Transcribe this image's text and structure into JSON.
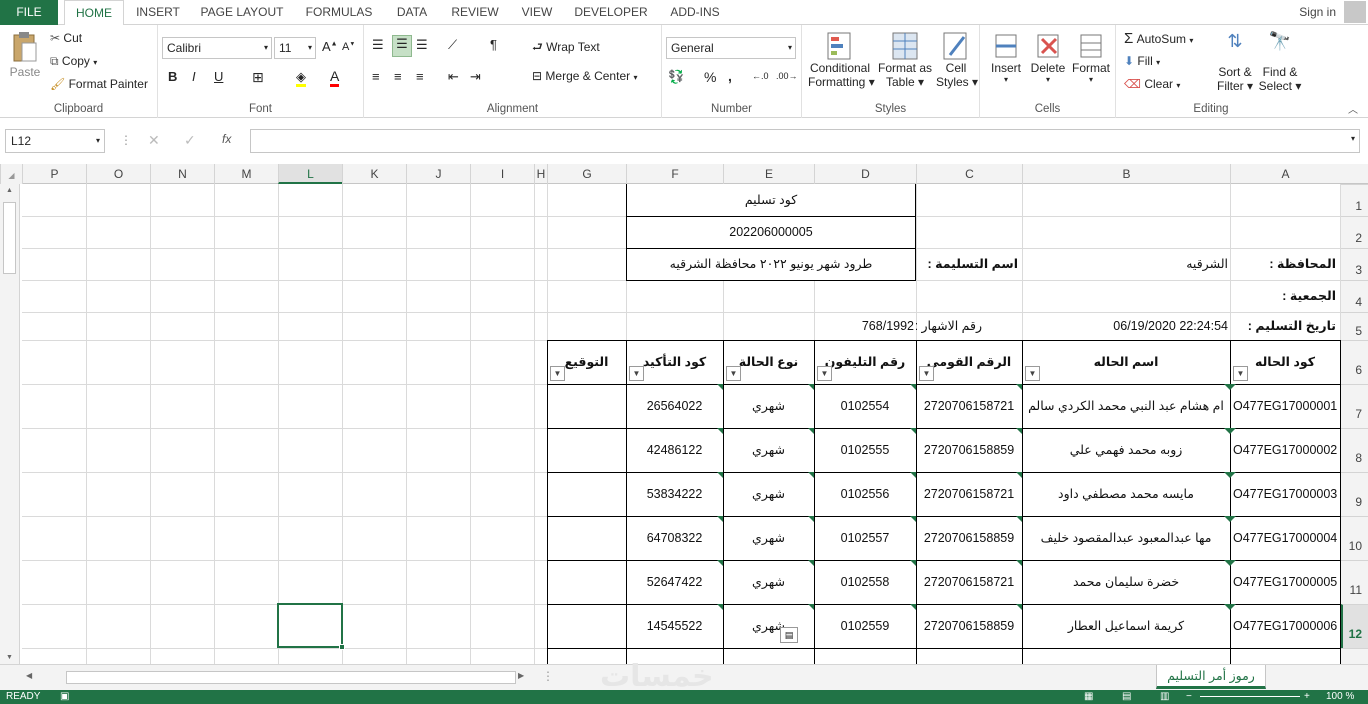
{
  "tabs": [
    "FILE",
    "HOME",
    "INSERT",
    "PAGE LAYOUT",
    "FORMULAS",
    "DATA",
    "REVIEW",
    "VIEW",
    "DEVELOPER",
    "ADD-INS"
  ],
  "signin": "Sign in",
  "clipboard": {
    "paste": "Paste",
    "cut": "Cut",
    "copy": "Copy",
    "format_painter": "Format Painter",
    "label": "Clipboard"
  },
  "font": {
    "name": "Calibri",
    "size": "11",
    "label": "Font",
    "bold": "B",
    "italic": "I",
    "underline": "U"
  },
  "alignment": {
    "wrap": "Wrap Text",
    "merge": "Merge & Center",
    "label": "Alignment"
  },
  "number": {
    "format": "General",
    "label": "Number",
    "percent": "%",
    "comma": ","
  },
  "styles": {
    "cond": "Conditional",
    "cond2": "Formatting",
    "fmt_table": "Format as",
    "fmt_table2": "Table",
    "cell_styles": "Cell",
    "cell_styles2": "Styles",
    "label": "Styles"
  },
  "cells": {
    "insert": "Insert",
    "delete": "Delete",
    "format": "Format",
    "label": "Cells"
  },
  "editing": {
    "autosum": "AutoSum",
    "fill": "Fill",
    "clear": "Clear",
    "sort": "Sort &",
    "sort2": "Filter",
    "find": "Find &",
    "find2": "Select",
    "label": "Editing"
  },
  "formula_bar": {
    "name_box": "L12",
    "fx": "fx",
    "value": ""
  },
  "columns": [
    {
      "id": "P"
    },
    {
      "id": "O"
    },
    {
      "id": "N"
    },
    {
      "id": "M"
    },
    {
      "id": "L"
    },
    {
      "id": "K"
    },
    {
      "id": "J"
    },
    {
      "id": "I"
    },
    {
      "id": "H"
    },
    {
      "id": "G"
    },
    {
      "id": "F"
    },
    {
      "id": "E"
    },
    {
      "id": "D"
    },
    {
      "id": "C"
    },
    {
      "id": "B"
    },
    {
      "id": "A"
    }
  ],
  "rows": [
    "1",
    "2",
    "3",
    "4",
    "5",
    "6",
    "7",
    "8",
    "9",
    "10",
    "11",
    "12"
  ],
  "header_block": {
    "code_label": "كود تسليم",
    "code_value": "202206000005",
    "description": "طرود شهر يونيو ٢٠٢٢ محافظة الشرقيه",
    "delivery_name_label": "اسم التسليمة :",
    "governorate_label": "المحافظة :",
    "governorate_value": "الشرقيه",
    "association_label": "الجمعية :",
    "delivery_date_label": "تاريخ التسليم :",
    "delivery_date_value": "06/19/2020 22:24:54",
    "announcement_label": "رقم الاشهار :",
    "announcement_value": "768/1992"
  },
  "table": {
    "headers": {
      "A": "كود الحاله",
      "B": "اسم الحاله",
      "C": "الرقم القومي",
      "D": "رقم التليفون",
      "E": "نوع الحالة",
      "F": "كود التأكيد",
      "G": "التوقيع"
    },
    "rows": [
      {
        "A": "O477EG17000001",
        "B": "ام هشام عبد النبي محمد الكردي سالم",
        "C": "2720706158721",
        "D": "0102554",
        "E": "شهري",
        "F": "26564022",
        "G": ""
      },
      {
        "A": "O477EG17000002",
        "B": "زوبه محمد فهمي علي",
        "C": "2720706158859",
        "D": "0102555",
        "E": "شهري",
        "F": "42486122",
        "G": ""
      },
      {
        "A": "O477EG17000003",
        "B": "مايسه محمد مصطفي داود",
        "C": "2720706158721",
        "D": "0102556",
        "E": "شهري",
        "F": "53834222",
        "G": ""
      },
      {
        "A": "O477EG17000004",
        "B": "مها عبدالمعبود عبدالمقصود خليف",
        "C": "2720706158859",
        "D": "0102557",
        "E": "شهري",
        "F": "64708322",
        "G": ""
      },
      {
        "A": "O477EG17000005",
        "B": "خضرة سليمان محمد",
        "C": "2720706158721",
        "D": "0102558",
        "E": "شهري",
        "F": "52647422",
        "G": ""
      },
      {
        "A": "O477EG17000006",
        "B": "كريمة اسماعيل العطار",
        "C": "2720706158859",
        "D": "0102559",
        "E": "شهري",
        "F": "14545522",
        "G": ""
      }
    ]
  },
  "sheet_tab": "رموز أمر التسليم",
  "watermark": "خمسات",
  "status": {
    "ready": "READY",
    "zoom": "100 %"
  },
  "colors": {
    "accent": "#217346",
    "grid": "#dadada"
  }
}
